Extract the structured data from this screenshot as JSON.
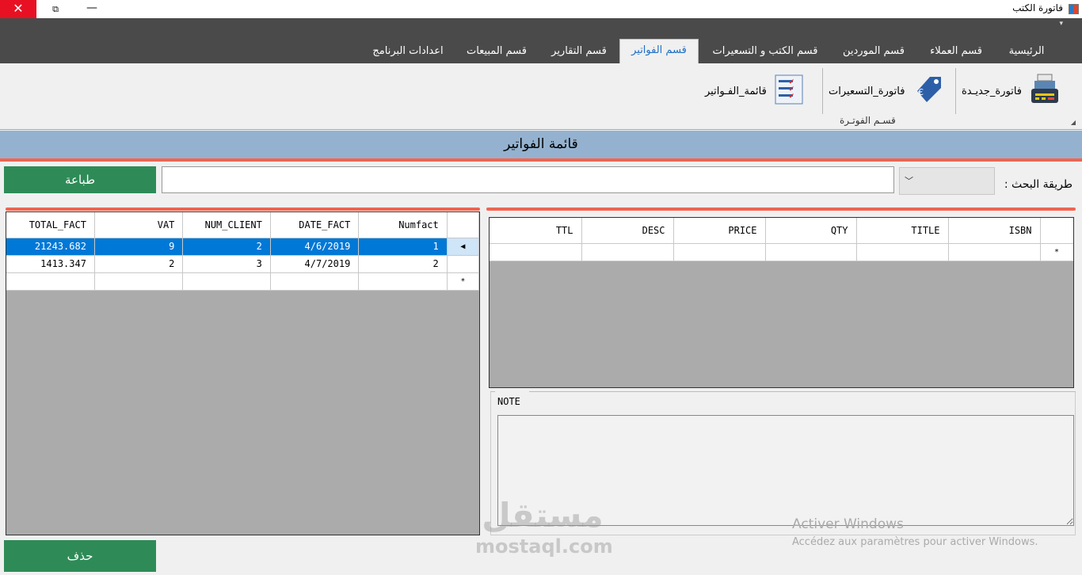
{
  "window": {
    "title": "فاتورة الكتب",
    "close_glyph": "✕",
    "max_glyph": "⧉",
    "min_glyph": "—"
  },
  "ribbon": {
    "tabs": [
      {
        "label": "الرئيسية"
      },
      {
        "label": "قسم العملاء"
      },
      {
        "label": "قسم الموردين"
      },
      {
        "label": "قسم الكتب و التسعيرات"
      },
      {
        "label": "قسم الفواتير",
        "active": true
      },
      {
        "label": "قسم التقارير"
      },
      {
        "label": "قسم المبيعات"
      },
      {
        "label": "اعدادات البرنامج"
      }
    ],
    "buttons": {
      "new_invoice": "فاتورة_جديـدة",
      "price_invoice": "فاتورة_التسعيرات",
      "invoice_list": "قائمة_الفـواتير"
    },
    "group_label": "قسـم الفوتـرة"
  },
  "header": {
    "title": "قائمة الفواتير"
  },
  "search": {
    "print_label": "طباعة",
    "value": "",
    "method_label": "طريقة البحث :",
    "select_value": "",
    "select_glyph": "﹀"
  },
  "invoices_grid": {
    "columns": [
      "TOTAL_FACT",
      "VAT",
      "NUM_CLIENT",
      "DATE_FACT",
      "Numfact"
    ],
    "rows": [
      {
        "total": "21243.682",
        "vat": "9",
        "client": "2",
        "date": "4/6/2019",
        "num": "1",
        "selected": true
      },
      {
        "total": "1413.347",
        "vat": "2",
        "client": "3",
        "date": "4/7/2019",
        "num": "2"
      }
    ],
    "current_marker": "◀",
    "new_row_marker": "*"
  },
  "details_grid": {
    "columns": [
      "TTL",
      "DESC",
      "PRICE",
      "QTY",
      "TITLE",
      "ISBN"
    ],
    "new_row_marker": "*"
  },
  "note": {
    "label": "NOTE",
    "value": ""
  },
  "delete_label": "حذف",
  "watermark": {
    "arabic": "مستقل",
    "latin": "mostaql.com"
  },
  "activation": {
    "line1": "Activer Windows",
    "line2": "Accédez aux paramètres pour activer Windows."
  },
  "colors": {
    "accent": "#f06450",
    "header": "#94b2cf",
    "button": "#2e8b57",
    "selection": "#0078d7"
  }
}
